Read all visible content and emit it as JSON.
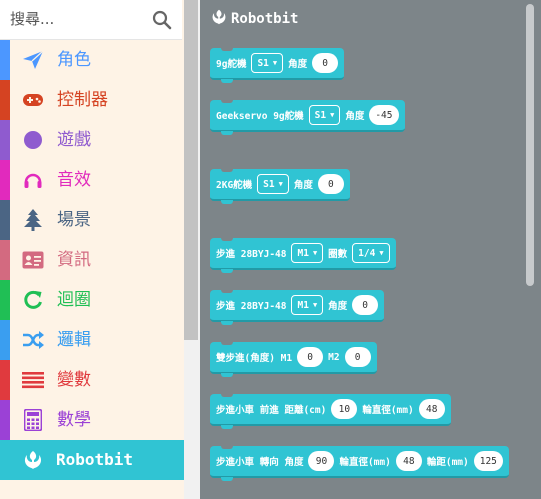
{
  "search": {
    "placeholder": "搜尋..."
  },
  "categories": [
    {
      "label": "角色",
      "color": "#4c97ff",
      "text_color": "#4c97ff",
      "icon": "paper-plane-icon"
    },
    {
      "label": "控制器",
      "color": "#d54322",
      "text_color": "#d54322",
      "icon": "gamepad-icon"
    },
    {
      "label": "遊戲",
      "color": "#8f5bcf",
      "text_color": "#8f5bcf",
      "icon": "circle-icon"
    },
    {
      "label": "音效",
      "color": "#e12abd",
      "text_color": "#e12abd",
      "icon": "headphones-icon"
    },
    {
      "label": "場景",
      "color": "#4b6584",
      "text_color": "#4b6584",
      "icon": "tree-icon"
    },
    {
      "label": "資訊",
      "color": "#d36a80",
      "text_color": "#d36a80",
      "icon": "id-card-icon"
    },
    {
      "label": "迴圈",
      "color": "#20bf55",
      "text_color": "#20bf55",
      "icon": "refresh-icon"
    },
    {
      "label": "邏輯",
      "color": "#3a9ef0",
      "text_color": "#3a9ef0",
      "icon": "shuffle-icon"
    },
    {
      "label": "變數",
      "color": "#e03a3e",
      "text_color": "#e03a3e",
      "icon": "list-icon"
    },
    {
      "label": "數學",
      "color": "#9b41d6",
      "text_color": "#9b41d6",
      "icon": "calculator-icon"
    },
    {
      "label": "Robotbit",
      "color": "#30c4d3",
      "text_color": "#ffffff",
      "icon": "rebel-icon",
      "selected": true
    }
  ],
  "flyout": {
    "title": "Robotbit",
    "blocks": [
      {
        "t1": "9g舵機",
        "d1": "S1",
        "t2": "角度",
        "n1": "0"
      },
      {
        "t1": "Geekservo 9g舵機",
        "d1": "S1",
        "t2": "角度",
        "n1": "-45"
      },
      {
        "t1": "2KG舵機",
        "d1": "S1",
        "t2": "角度",
        "n1": "0"
      },
      {
        "t1": "步進 28BYJ-48",
        "d1": "M1",
        "t2": "圈數",
        "d2": "1/4"
      },
      {
        "t1": "步進 28BYJ-48",
        "d1": "M1",
        "t2": "角度",
        "n1": "0"
      },
      {
        "t1": "雙步進(角度) M1",
        "n1": "0",
        "t2": "M2",
        "n2": "0"
      },
      {
        "t1": "步進小車 前進 距離(cm)",
        "n1": "10",
        "t2": "輪直徑(mm)",
        "n2": "48"
      },
      {
        "t1": "步進小車 轉向 角度",
        "n1": "90",
        "t2": "輪直徑(mm)",
        "n2": "48",
        "t3": "輪距(mm)",
        "n3": "125"
      }
    ]
  }
}
